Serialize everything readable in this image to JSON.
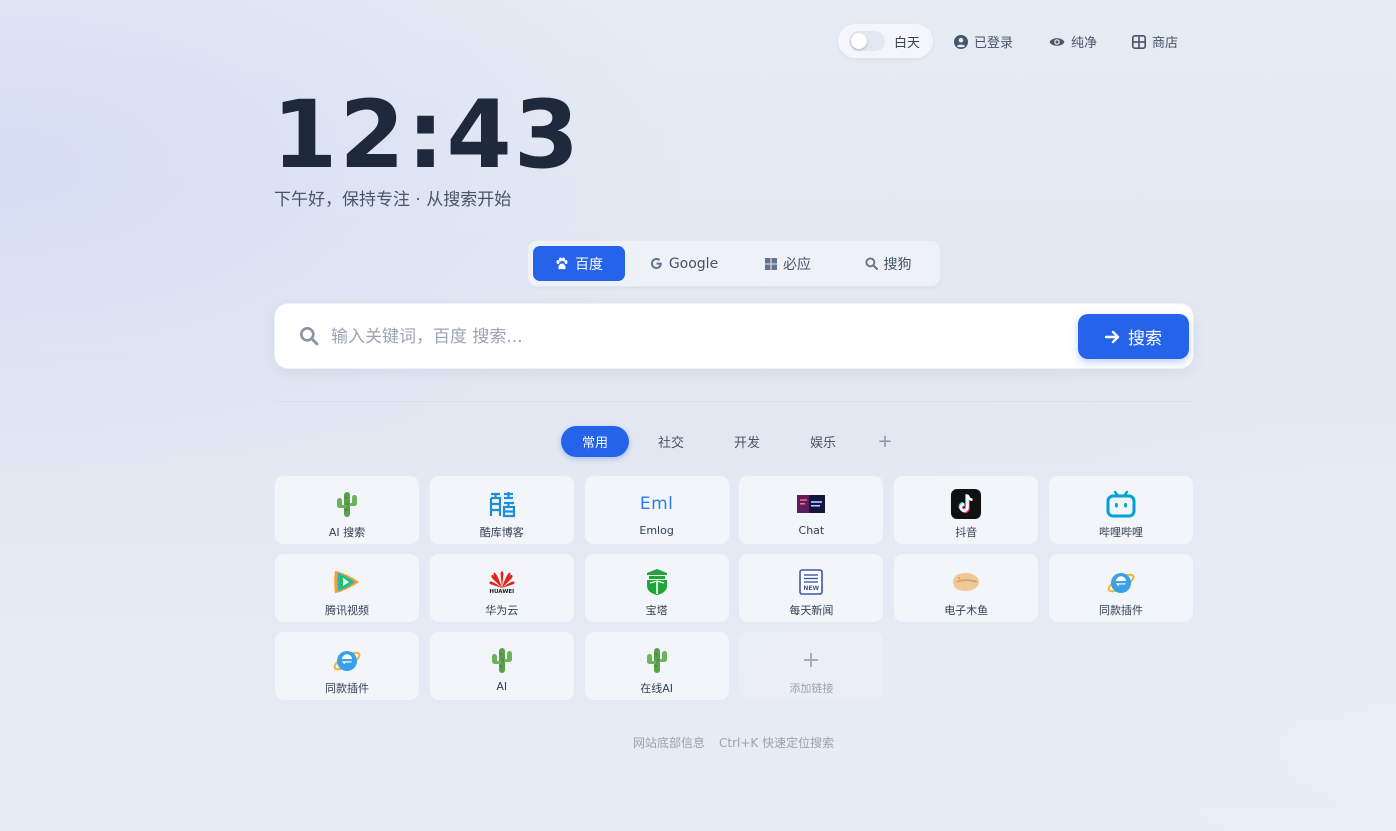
{
  "topbar": {
    "theme_label": "白天",
    "login_label": "已登录",
    "pure_label": "纯净",
    "shop_label": "商店"
  },
  "clock": {
    "time": "12:43",
    "greeting": "下午好，保持专注 · 从搜索开始"
  },
  "engines": [
    {
      "label": "百度",
      "icon": "paw-icon",
      "active": true
    },
    {
      "label": "Google",
      "icon": "google-g-icon",
      "active": false
    },
    {
      "label": "必应",
      "icon": "windows-icon",
      "active": false
    },
    {
      "label": "搜狗",
      "icon": "search-icon",
      "active": false
    }
  ],
  "search": {
    "placeholder": "输入关键词，百度 搜索...",
    "value": "",
    "button_label": "搜索"
  },
  "categories": [
    {
      "label": "常用",
      "active": true
    },
    {
      "label": "社交",
      "active": false
    },
    {
      "label": "开发",
      "active": false
    },
    {
      "label": "娱乐",
      "active": false
    }
  ],
  "category_add": "+",
  "links": [
    {
      "label": "AI 搜索",
      "icon": "cactus-icon"
    },
    {
      "label": "酷库博客",
      "icon": "ku-logo-icon"
    },
    {
      "label": "Emlog",
      "icon": "emlog-logo-icon",
      "icon_text": "Eml"
    },
    {
      "label": "Chat",
      "icon": "chat-thumbnail-icon"
    },
    {
      "label": "抖音",
      "icon": "douyin-icon"
    },
    {
      "label": "哔哩哔哩",
      "icon": "bilibili-icon"
    },
    {
      "label": "腾讯视频",
      "icon": "tencent-video-icon"
    },
    {
      "label": "华为云",
      "icon": "huawei-icon",
      "icon_text": "HUAWEI"
    },
    {
      "label": "宝塔",
      "icon": "baota-icon"
    },
    {
      "label": "每天新闻",
      "icon": "news-icon",
      "icon_text": "NEW"
    },
    {
      "label": "电子木鱼",
      "icon": "wooden-fish-icon"
    },
    {
      "label": "同款插件",
      "icon": "ie-icon"
    },
    {
      "label": "同款插件",
      "icon": "ie-icon"
    },
    {
      "label": "AI",
      "icon": "cactus-icon"
    },
    {
      "label": "在线AI",
      "icon": "cactus-icon"
    }
  ],
  "add_link": {
    "label": "添加链接",
    "icon": "plus-icon"
  },
  "footer": {
    "info": "网站底部信息",
    "shortcut": "Ctrl+K 快速定位搜索"
  },
  "colors": {
    "accent": "#2563eb",
    "text": "#1e293b",
    "muted": "#475569"
  }
}
